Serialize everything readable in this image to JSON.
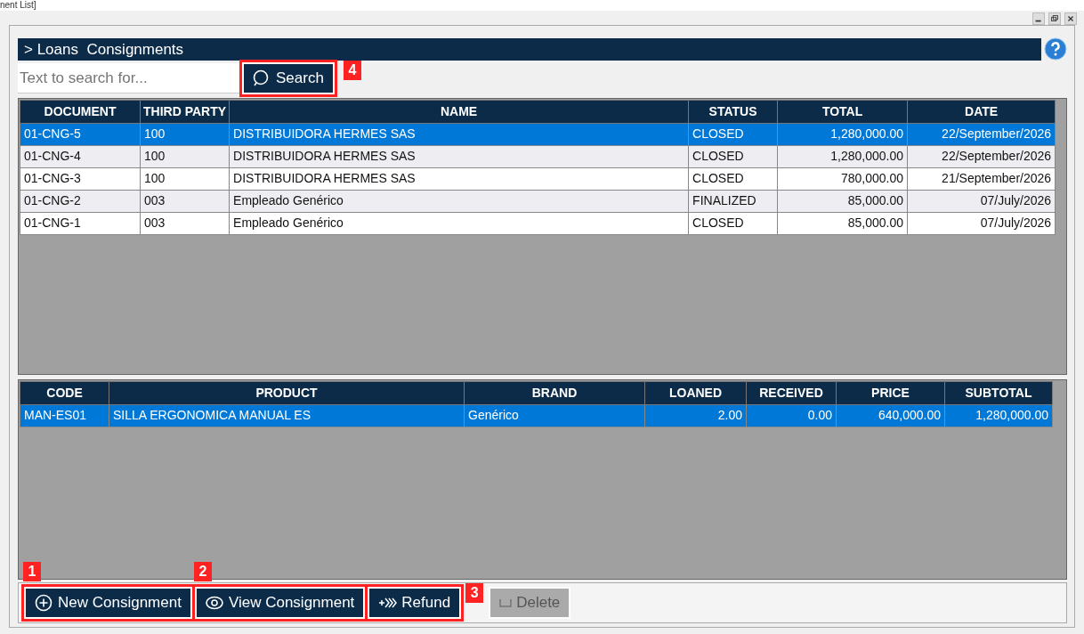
{
  "window": {
    "title": "nent List]"
  },
  "panel": {
    "title": "> Loans  Consignments"
  },
  "search": {
    "placeholder": "Text to search for...",
    "button": {
      "label": "Search",
      "callout": "4"
    }
  },
  "documents": {
    "columns": [
      {
        "label": "DOCUMENT",
        "kind": "text"
      },
      {
        "label": "THIRD PARTY",
        "kind": "text"
      },
      {
        "label": "NAME",
        "kind": "text"
      },
      {
        "label": "STATUS",
        "kind": "text"
      },
      {
        "label": "TOTAL",
        "kind": "number"
      },
      {
        "label": "DATE",
        "kind": "date"
      }
    ],
    "rows": [
      {
        "selected": true,
        "cells": [
          "01-CNG-5",
          "100",
          "DISTRIBUIDORA HERMES SAS",
          "CLOSED",
          "1,280,000.00",
          "22/September/2026"
        ]
      },
      {
        "selected": false,
        "cells": [
          "01-CNG-4",
          "100",
          "DISTRIBUIDORA HERMES SAS",
          "CLOSED",
          "1,280,000.00",
          "22/September/2026"
        ]
      },
      {
        "selected": false,
        "cells": [
          "01-CNG-3",
          "100",
          "DISTRIBUIDORA HERMES SAS",
          "CLOSED",
          "780,000.00",
          "21/September/2026"
        ]
      },
      {
        "selected": false,
        "cells": [
          "01-CNG-2",
          "003",
          "Empleado Genérico",
          "FINALIZED",
          "85,000.00",
          "07/July/2026"
        ]
      },
      {
        "selected": false,
        "cells": [
          "01-CNG-1",
          "003",
          "Empleado Genérico",
          "CLOSED",
          "85,000.00",
          "07/July/2026"
        ]
      }
    ]
  },
  "items": {
    "columns": [
      {
        "label": "CODE",
        "kind": "text"
      },
      {
        "label": "PRODUCT",
        "kind": "text"
      },
      {
        "label": "BRAND",
        "kind": "text"
      },
      {
        "label": "LOANED",
        "kind": "number"
      },
      {
        "label": "RECEIVED",
        "kind": "number"
      },
      {
        "label": "PRICE",
        "kind": "number"
      },
      {
        "label": "SUBTOTAL",
        "kind": "number"
      }
    ],
    "rows": [
      {
        "selected": true,
        "cells": [
          "MAN-ES01",
          "SILLA ERGONOMICA MANUAL ES",
          "Genérico",
          "2.00",
          "0.00",
          "640,000.00",
          "1,280,000.00"
        ]
      }
    ]
  },
  "buttons": [
    {
      "kind": "new",
      "label": "New Consignment",
      "disabled": false,
      "callout": "1"
    },
    {
      "kind": "view",
      "label": "View Consignment",
      "disabled": false,
      "callout": "2"
    },
    {
      "kind": "refund",
      "label": "Refund",
      "disabled": false,
      "callout": "3"
    },
    {
      "kind": "delete",
      "label": "Delete",
      "disabled": true
    }
  ]
}
